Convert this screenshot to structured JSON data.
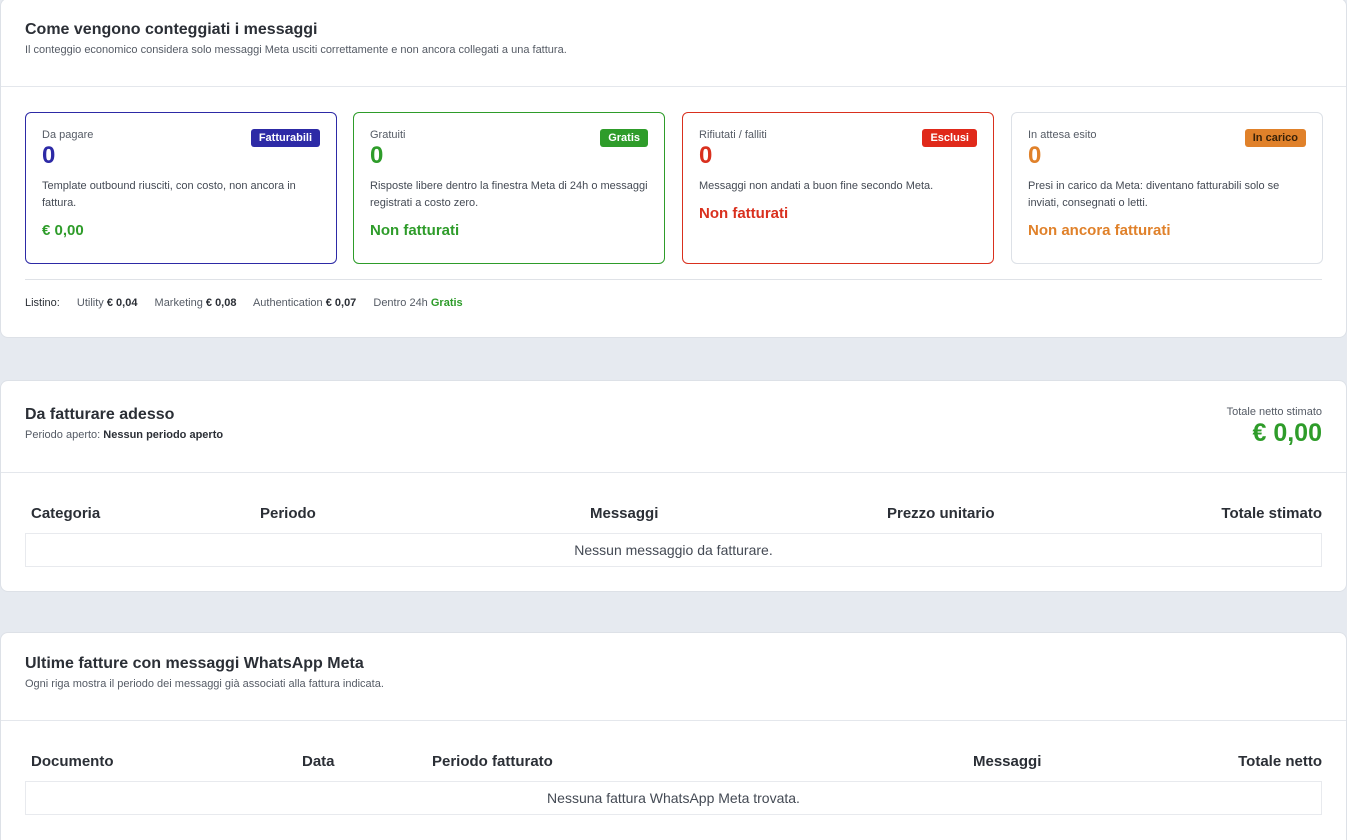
{
  "counting": {
    "title": "Come vengono conteggiati i messaggi",
    "subtitle": "Il conteggio economico considera solo messaggi Meta usciti correttamente e non ancora collegati a una fattura.",
    "tiles": [
      {
        "label": "Da pagare",
        "badge": "Fatturabili",
        "count": "0",
        "desc": "Template outbound riusciti, con costo, non ancora in fattura.",
        "foot": "€ 0,00",
        "color": "#2d2aa6"
      },
      {
        "label": "Gratuiti",
        "badge": "Gratis",
        "count": "0",
        "desc": "Risposte libere dentro la finestra Meta di 24h o messaggi registrati a costo zero.",
        "foot": "Non fatturati",
        "color": "#2e9c2a"
      },
      {
        "label": "Rifiutati / falliti",
        "badge": "Esclusi",
        "count": "0",
        "desc": "Messaggi non andati a buon fine secondo Meta.",
        "foot": "Non fatturati",
        "color": "#d9301e"
      },
      {
        "label": "In attesa esito",
        "badge": "In carico",
        "count": "0",
        "desc": "Presi in carico da Meta: diventano fatturabili solo se inviati, consegnati o letti.",
        "foot": "Non ancora fatturati",
        "color": "#e0812a"
      }
    ],
    "pricelist": {
      "label": "Listino:",
      "items": [
        {
          "name": "Utility",
          "price": "€ 0,04"
        },
        {
          "name": "Marketing",
          "price": "€ 0,08"
        },
        {
          "name": "Authentication",
          "price": "€ 0,07"
        },
        {
          "name": "Dentro 24h",
          "price": "Gratis"
        }
      ]
    }
  },
  "billing": {
    "title": "Da fatturare adesso",
    "period_prefix": "Periodo aperto:",
    "period_value": "Nessun periodo aperto",
    "total_label": "Totale netto stimato",
    "total_value": "€ 0,00",
    "columns": [
      "Categoria",
      "Periodo",
      "Messaggi",
      "Prezzo unitario",
      "Totale stimato"
    ],
    "empty": "Nessun messaggio da fatturare."
  },
  "invoices": {
    "title": "Ultime fatture con messaggi WhatsApp Meta",
    "subtitle": "Ogni riga mostra il periodo dei messaggi già associati alla fattura indicata.",
    "columns": [
      "Documento",
      "Data",
      "Periodo fatturato",
      "Messaggi",
      "Totale netto"
    ],
    "empty": "Nessuna fattura WhatsApp Meta trovata."
  },
  "colors": {
    "billable_bg": "#2d2aa6",
    "free_bg": "#2e9c2a",
    "excluded_bg": "#e0291a",
    "pending_bg": "#e0812a",
    "pending_badge_text": "#3a2208"
  }
}
